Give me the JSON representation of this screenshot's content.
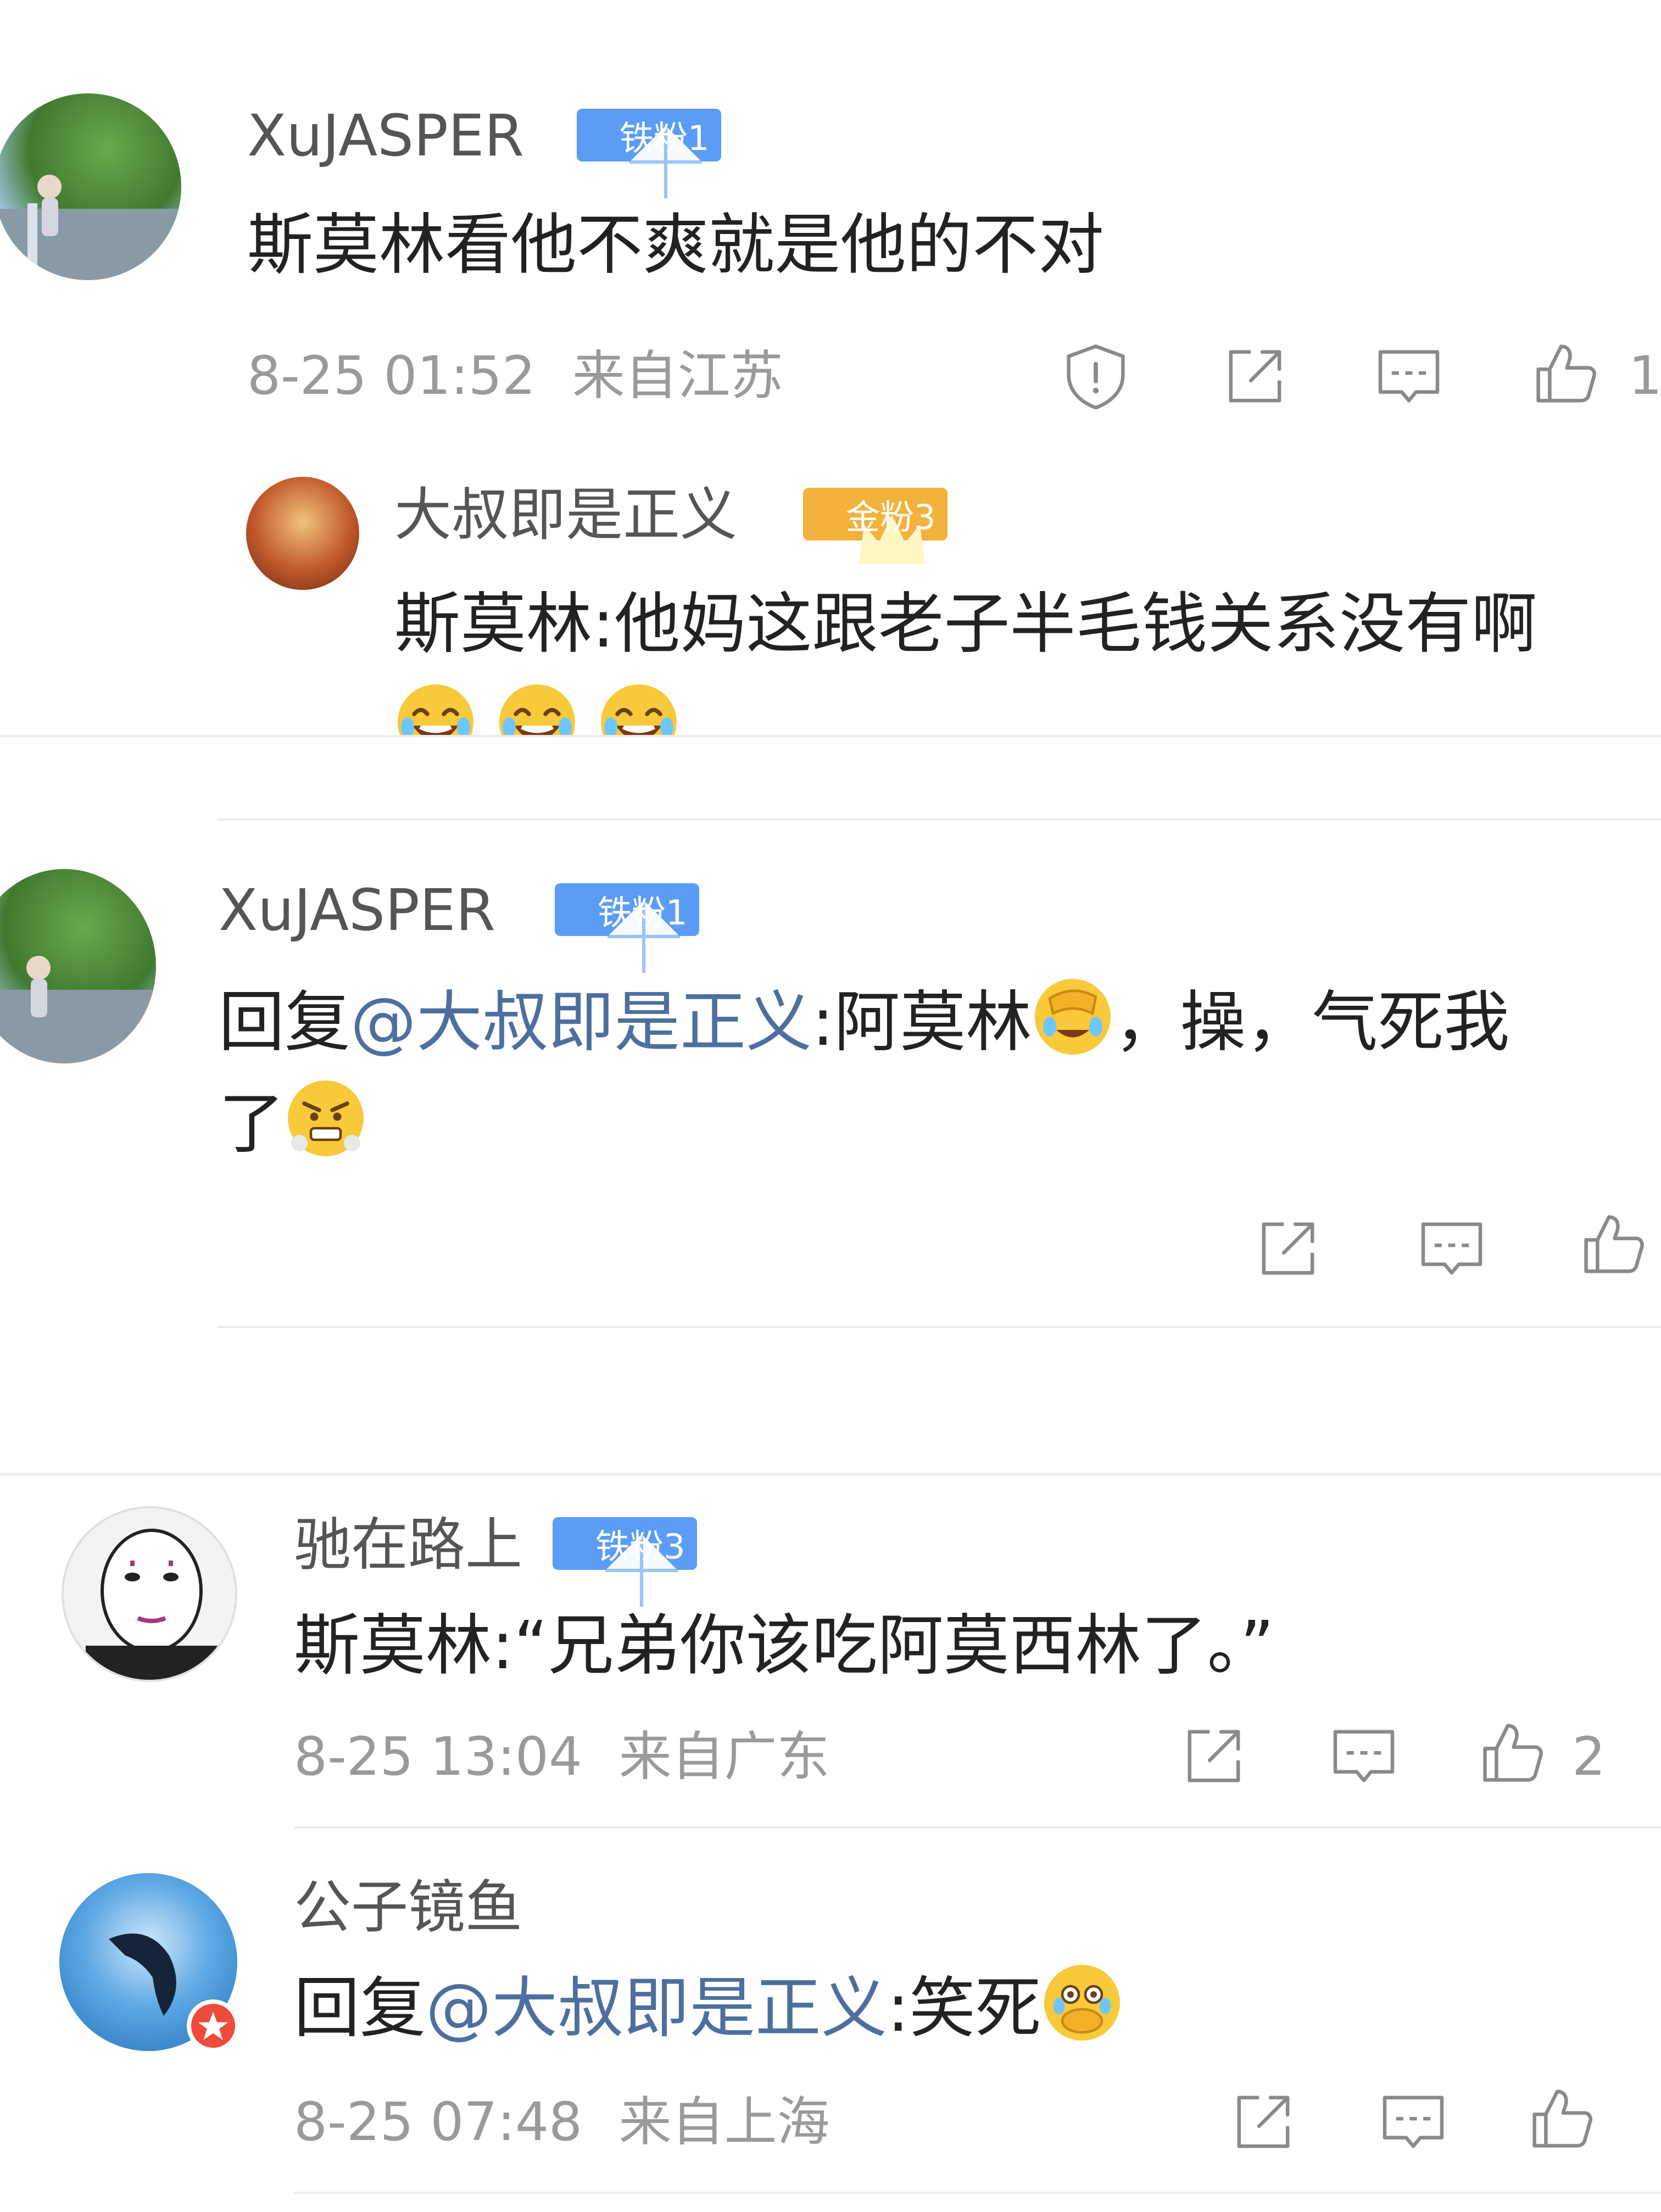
{
  "comments": [
    {
      "user": "XuJASPER",
      "badge": "铁粉1",
      "text": "斯莫林看他不爽就是他的不对",
      "time": "8-25 01:52",
      "location": "来自江苏",
      "likes": "1",
      "reply": {
        "user": "大叔即是正义",
        "badge": "金粉3",
        "text": "斯莫林:他妈这跟老子半毛钱关系没有啊"
      }
    },
    {
      "user": "XuJASPER",
      "badge": "铁粉1",
      "reply_prefix": "回复",
      "mention": "@大叔即是正义",
      "text_a": ":阿莫林",
      "text_b": "，操，气死我",
      "text_c": "了"
    },
    {
      "user": "驰在路上",
      "badge": "铁粉3",
      "text": "斯莫林:“兄弟你该吃阿莫西林了。”",
      "time": "8-25 13:04",
      "location": "来自广东",
      "likes": "2"
    },
    {
      "user": "公子镜鱼",
      "reply_prefix": "回复",
      "mention": "@大叔即是正义",
      "text_a": ":笑死",
      "time": "8-25 07:48",
      "location": "来自上海"
    }
  ],
  "icons": {
    "report": "report-icon",
    "repost": "repost-icon",
    "comment": "comment-icon",
    "like": "like-icon"
  },
  "colors": {
    "iron_badge": "#5b9df6",
    "gold_badge": "#f3b23b",
    "mention": "#4d6fa0",
    "meta": "#9a9a9a"
  }
}
